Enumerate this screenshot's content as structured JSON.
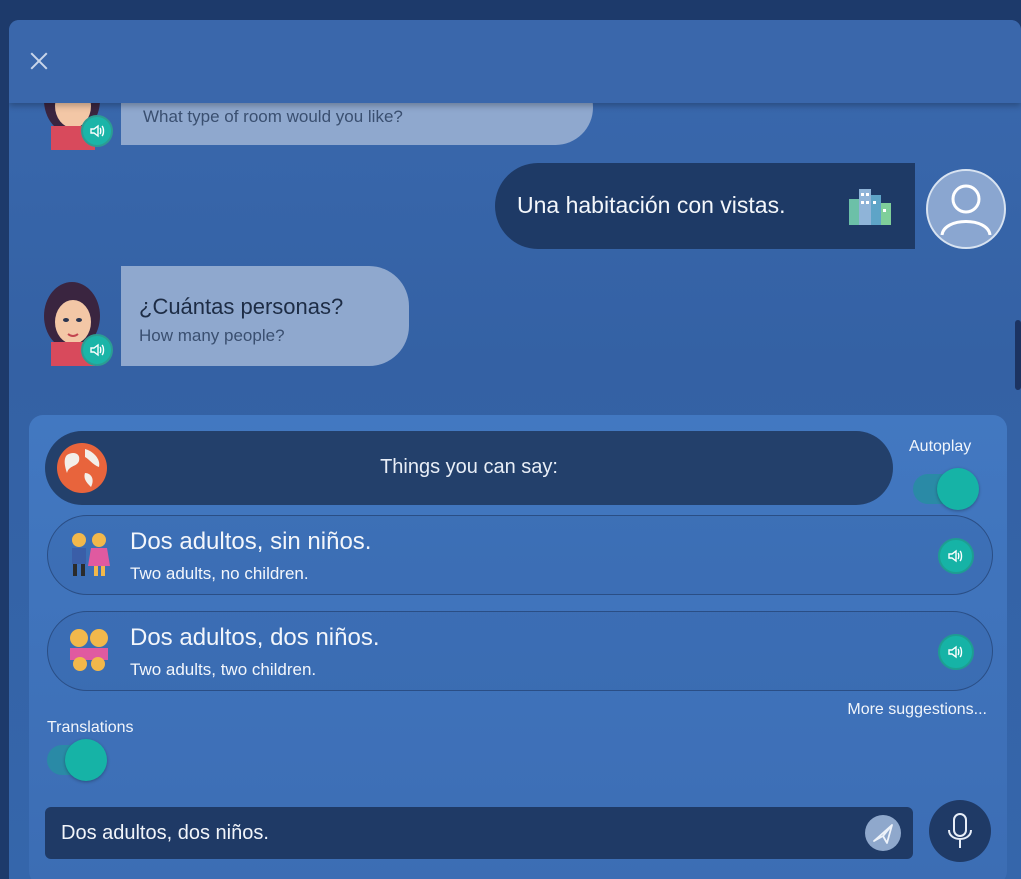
{
  "window": {
    "close_icon": "close-icon"
  },
  "conversation": {
    "prev_bot_message": {
      "sub": "What type of room would you like?"
    },
    "user_message": {
      "text": "Una habitación con vistas.",
      "emoji": "cityscape-icon"
    },
    "bot_message": {
      "main": "¿Cuántas personas?",
      "sub": "How many people?"
    }
  },
  "panel": {
    "header_title": "Things you can say:",
    "autoplay_label": "Autoplay",
    "autoplay_on": true,
    "suggestions": [
      {
        "main": "Dos adultos, sin niños.",
        "sub": "Two adults, no children.",
        "icon": "couple-icon"
      },
      {
        "main": "Dos adultos, dos niños.",
        "sub": "Two adults, two children.",
        "icon": "family-icon"
      }
    ],
    "more_label": "More suggestions...",
    "translations_label": "Translations",
    "translations_on": true
  },
  "input": {
    "value": "Dos adultos, dos niños."
  },
  "colors": {
    "accent": "#16b3a6",
    "panel": "#3c6db4",
    "user_bubble": "#1e3a66",
    "bot_bubble": "#8fa8ce"
  }
}
